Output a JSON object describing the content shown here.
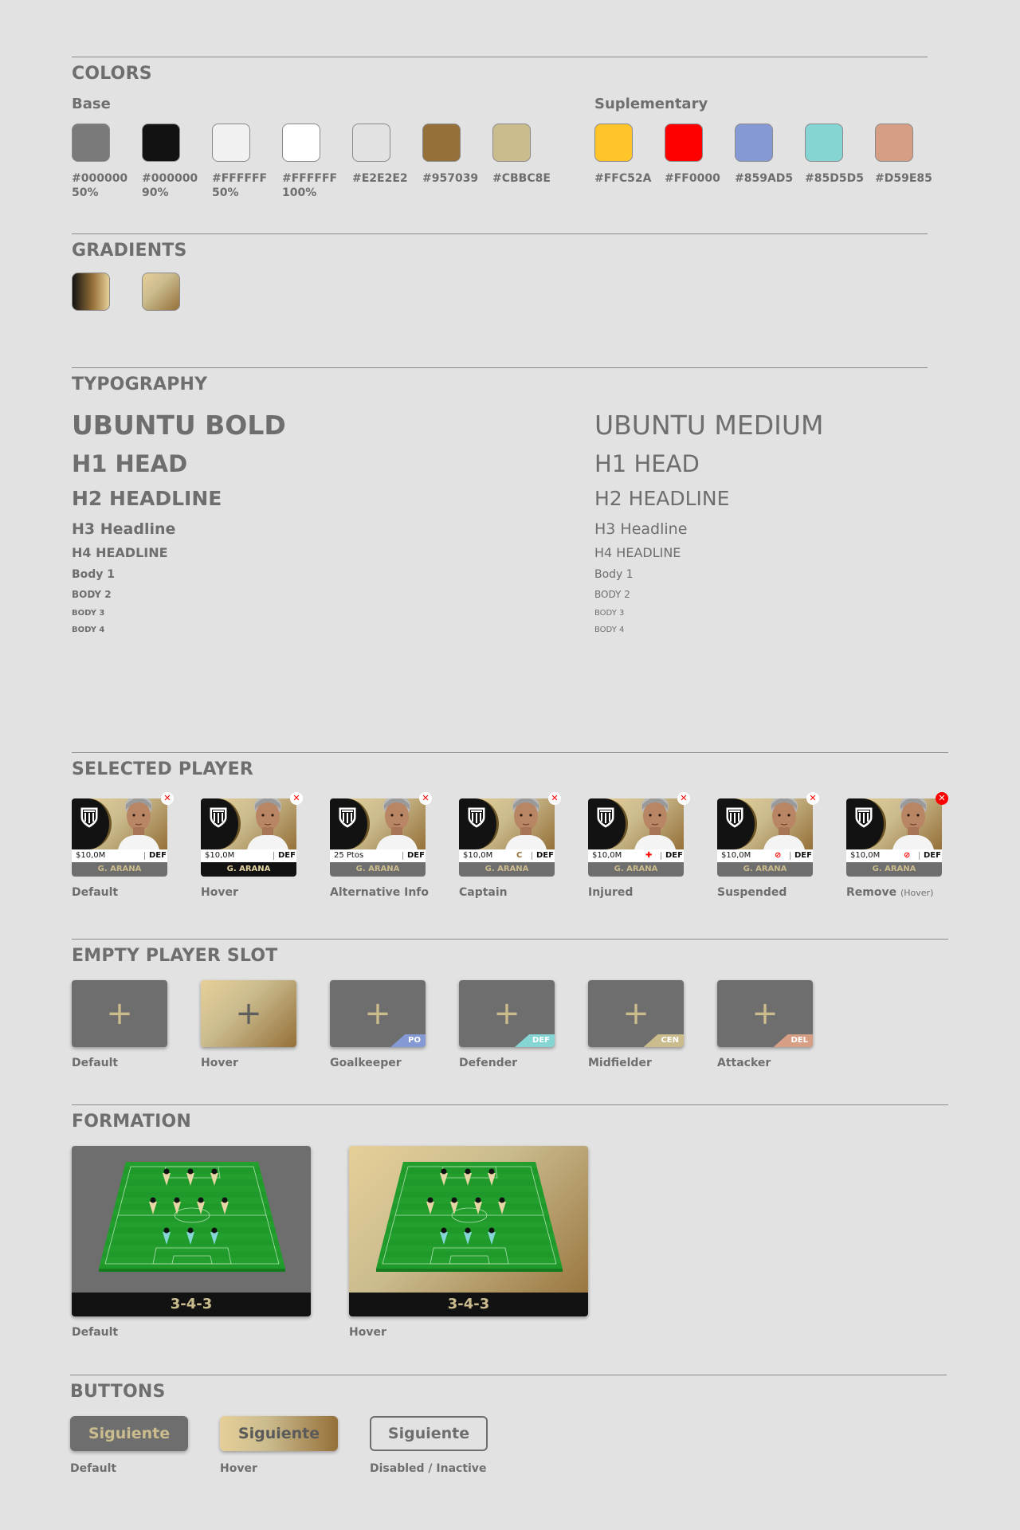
{
  "colors": {
    "title": "COLORS",
    "base_title": "Base",
    "supp_title": "Suplementary",
    "base": [
      {
        "hex": "#7a7a7a",
        "label": "#000000\n50%"
      },
      {
        "hex": "#121212",
        "label": "#000000\n90%"
      },
      {
        "hex": "#f1f1f1",
        "label": "#FFFFFF\n50%"
      },
      {
        "hex": "#FFFFFF",
        "label": "#FFFFFF\n100%"
      },
      {
        "hex": "#E2E2E2",
        "label": "#E2E2E2"
      },
      {
        "hex": "#957039",
        "label": "#957039"
      },
      {
        "hex": "#CBBC8E",
        "label": "#CBBC8E"
      }
    ],
    "supplementary": [
      {
        "hex": "#FFC52A",
        "label": "#FFC52A"
      },
      {
        "hex": "#FF0000",
        "label": "#FF0000"
      },
      {
        "hex": "#859AD5",
        "label": "#859AD5"
      },
      {
        "hex": "#85D5D5",
        "label": "#85D5D5"
      },
      {
        "hex": "#D59E85",
        "label": "#D59E85"
      }
    ]
  },
  "gradients": {
    "title": "GRADIENTS",
    "items": [
      {
        "from": "#121212",
        "to": "#957039"
      },
      {
        "from": "#CBBC8E",
        "to": "#957039"
      }
    ]
  },
  "typography": {
    "title": "TYPOGRAPHY",
    "bold": {
      "title": "UBUNTU BOLD",
      "h1": "H1 HEAD",
      "h2": "H2 HEADLINE",
      "h3": "H3 Headline",
      "h4": "H4 HEADLINE",
      "b1": "Body 1",
      "b2": "BODY 2",
      "b3": "BODY 3",
      "b4": "BODY 4"
    },
    "medium": {
      "title": "UBUNTU MEDIUM",
      "h1": "H1 HEAD",
      "h2": "H2 HEADLINE",
      "h3": "H3 Headline",
      "h4": "H4 HEADLINE",
      "b1": "Body 1",
      "b2": "BODY 2",
      "b3": "BODY 3",
      "b4": "BODY 4"
    }
  },
  "selected_player": {
    "title": "SELECTED PLAYER",
    "cards": [
      {
        "label": "Default",
        "value": "$10,0M",
        "position": "DEF",
        "name": "G. ARANA",
        "mark": "",
        "remove_icon": "close-icon"
      },
      {
        "label": "Hover",
        "value": "$10,0M",
        "position": "DEF",
        "name": "G. ARANA",
        "mark": "",
        "remove_icon": "close-icon"
      },
      {
        "label": "Alternative Info",
        "value": "25 Ptos",
        "position": "DEF",
        "name": "G. ARANA",
        "mark": "",
        "remove_icon": "close-icon"
      },
      {
        "label": "Captain",
        "value": "$10,0M",
        "position": "DEF",
        "name": "G. ARANA",
        "mark": "C",
        "mark_color": "#957039",
        "remove_icon": "close-icon"
      },
      {
        "label": "Injured",
        "value": "$10,0M",
        "position": "DEF",
        "name": "G. ARANA",
        "mark": "✚",
        "mark_color": "#FF0000",
        "remove_icon": "close-icon"
      },
      {
        "label": "Suspended",
        "value": "$10,0M",
        "position": "DEF",
        "name": "G. ARANA",
        "mark": "⊘",
        "mark_color": "#FF0000",
        "remove_icon": "close-icon"
      },
      {
        "label": "Remove",
        "label_note": "(Hover)",
        "value": "$10,0M",
        "position": "DEF",
        "name": "G. ARANA",
        "mark": "⊘",
        "mark_color": "#FF0000",
        "remove_icon": "close-icon"
      }
    ]
  },
  "empty_slot": {
    "title": "EMPTY PLAYER SLOT",
    "plus": "+",
    "slots": [
      {
        "label": "Default",
        "tag": "",
        "tag_color": ""
      },
      {
        "label": "Hover",
        "tag": "",
        "tag_color": ""
      },
      {
        "label": "Goalkeeper",
        "tag": "PO",
        "tag_color": "#859AD5"
      },
      {
        "label": "Defender",
        "tag": "DEF",
        "tag_color": "#85D5D5"
      },
      {
        "label": "Midfielder",
        "tag": "CEN",
        "tag_color": "#CBBC8E"
      },
      {
        "label": "Attacker",
        "tag": "DEL",
        "tag_color": "#D59E85"
      }
    ]
  },
  "formation": {
    "title": "FORMATION",
    "items": [
      {
        "label": "Default",
        "name": "3-4-3"
      },
      {
        "label": "Hover",
        "name": "3-4-3"
      }
    ]
  },
  "buttons": {
    "title": "BUTTONS",
    "items": [
      {
        "label": "Default",
        "text": "Siguiente"
      },
      {
        "label": "Hover",
        "text": "Siguiente"
      },
      {
        "label": "Disabled / Inactive",
        "text": "Siguiente"
      }
    ]
  }
}
